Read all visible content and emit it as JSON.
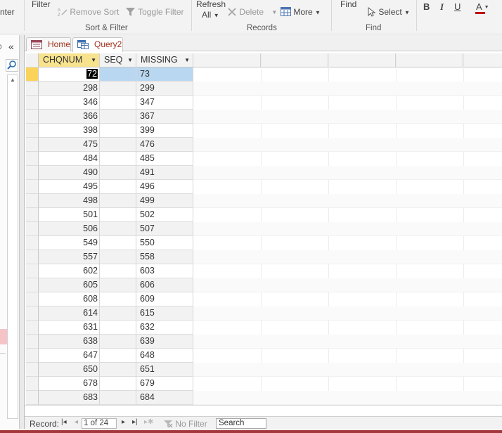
{
  "ribbon": {
    "enter_label": "nter",
    "filter_label": "Filter",
    "remove_sort_label": "Remove Sort",
    "toggle_filter_label": "Toggle Filter",
    "sort_filter_group": "Sort & Filter",
    "refresh_label": "Refresh",
    "refresh_all_label": "All",
    "delete_label": "Delete",
    "more_label": "More",
    "records_group": "Records",
    "find_label": "Find",
    "select_label": "Select",
    "find_group": "Find",
    "bold_label": "B",
    "italic_label": "I",
    "underline_label": "U",
    "font_color_label": "A",
    "font_color": "#c00000"
  },
  "tabs": [
    {
      "label": "Home"
    },
    {
      "label": "Query2"
    }
  ],
  "grid": {
    "columns": [
      "CHQNUM",
      "SEQ",
      "MISSING"
    ],
    "rows": [
      {
        "chqnum": "72",
        "seq": "",
        "missing": "73"
      },
      {
        "chqnum": "298",
        "seq": "",
        "missing": "299"
      },
      {
        "chqnum": "346",
        "seq": "",
        "missing": "347"
      },
      {
        "chqnum": "366",
        "seq": "",
        "missing": "367"
      },
      {
        "chqnum": "398",
        "seq": "",
        "missing": "399"
      },
      {
        "chqnum": "475",
        "seq": "",
        "missing": "476"
      },
      {
        "chqnum": "484",
        "seq": "",
        "missing": "485"
      },
      {
        "chqnum": "490",
        "seq": "",
        "missing": "491"
      },
      {
        "chqnum": "495",
        "seq": "",
        "missing": "496"
      },
      {
        "chqnum": "498",
        "seq": "",
        "missing": "499"
      },
      {
        "chqnum": "501",
        "seq": "",
        "missing": "502"
      },
      {
        "chqnum": "506",
        "seq": "",
        "missing": "507"
      },
      {
        "chqnum": "549",
        "seq": "",
        "missing": "550"
      },
      {
        "chqnum": "557",
        "seq": "",
        "missing": "558"
      },
      {
        "chqnum": "602",
        "seq": "",
        "missing": "603"
      },
      {
        "chqnum": "605",
        "seq": "",
        "missing": "606"
      },
      {
        "chqnum": "608",
        "seq": "",
        "missing": "609"
      },
      {
        "chqnum": "614",
        "seq": "",
        "missing": "615"
      },
      {
        "chqnum": "631",
        "seq": "",
        "missing": "632"
      },
      {
        "chqnum": "638",
        "seq": "",
        "missing": "639"
      },
      {
        "chqnum": "647",
        "seq": "",
        "missing": "648"
      },
      {
        "chqnum": "650",
        "seq": "",
        "missing": "651"
      },
      {
        "chqnum": "678",
        "seq": "",
        "missing": "679"
      },
      {
        "chqnum": "683",
        "seq": "",
        "missing": "684"
      }
    ]
  },
  "status": {
    "record_label": "Record:",
    "position_value": "1 of 24",
    "no_filter_label": "No Filter",
    "search_placeholder": "Search"
  },
  "colors": {
    "accent": "#a4373a",
    "selected_header": "#f7e28e",
    "selected_cell": "#b9d7f0",
    "current_row": "#fbd35a"
  }
}
